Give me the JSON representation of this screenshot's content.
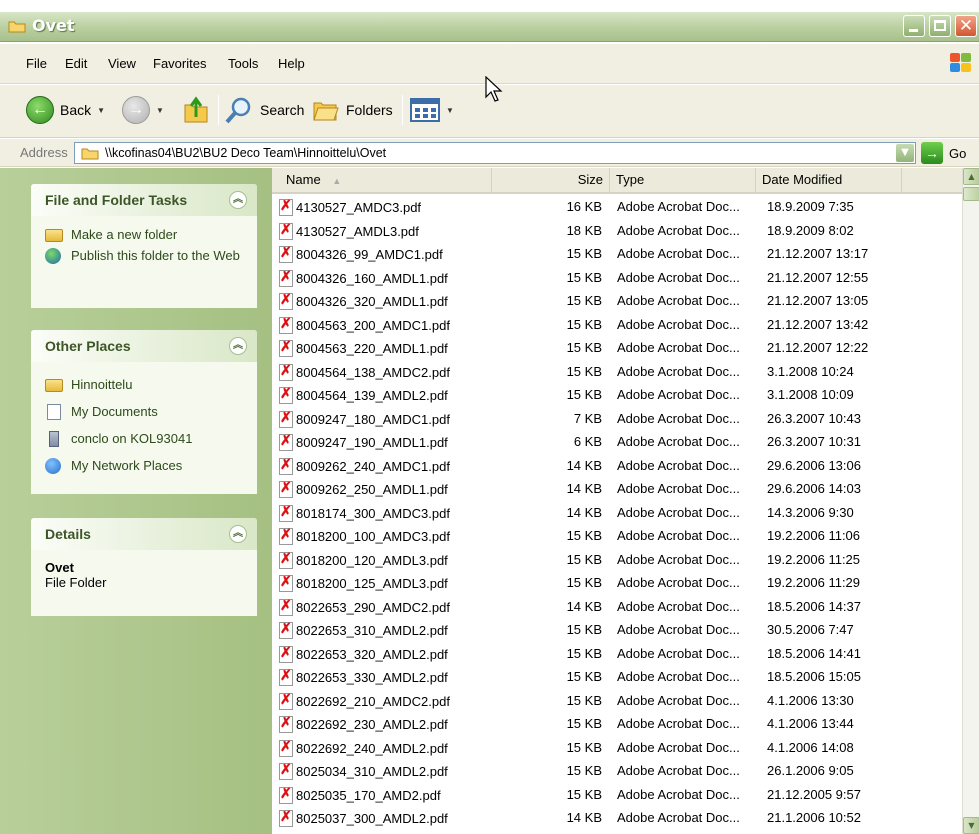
{
  "window": {
    "title": "Ovet"
  },
  "menu": [
    "File",
    "Edit",
    "View",
    "Favorites",
    "Tools",
    "Help"
  ],
  "toolbar": {
    "back": "Back",
    "search": "Search",
    "folders": "Folders"
  },
  "address": {
    "label": "Address",
    "path": "\\\\kcofinas04\\BU2\\BU2 Deco Team\\Hinnoittelu\\Ovet",
    "go": "Go"
  },
  "tasks_panel": {
    "title": "File and Folder Tasks",
    "items": [
      "Make a new folder",
      "Publish this folder to the Web"
    ]
  },
  "places_panel": {
    "title": "Other Places",
    "items": [
      "Hinnoittelu",
      "My Documents",
      "conclo on KOL93041",
      "My Network Places"
    ]
  },
  "details_panel": {
    "title": "Details",
    "name": "Ovet",
    "type": "File Folder"
  },
  "columns": {
    "name": "Name",
    "size": "Size",
    "type": "Type",
    "date": "Date Modified"
  },
  "files": [
    {
      "name": "4130527_AMDC3.pdf",
      "size": "16 KB",
      "type": "Adobe Acrobat Doc...",
      "date": "18.9.2009 7:35"
    },
    {
      "name": "4130527_AMDL3.pdf",
      "size": "18 KB",
      "type": "Adobe Acrobat Doc...",
      "date": "18.9.2009 8:02"
    },
    {
      "name": "8004326_99_AMDC1.pdf",
      "size": "15 KB",
      "type": "Adobe Acrobat Doc...",
      "date": "21.12.2007 13:17"
    },
    {
      "name": "8004326_160_AMDL1.pdf",
      "size": "15 KB",
      "type": "Adobe Acrobat Doc...",
      "date": "21.12.2007 12:55"
    },
    {
      "name": "8004326_320_AMDL1.pdf",
      "size": "15 KB",
      "type": "Adobe Acrobat Doc...",
      "date": "21.12.2007 13:05"
    },
    {
      "name": "8004563_200_AMDC1.pdf",
      "size": "15 KB",
      "type": "Adobe Acrobat Doc...",
      "date": "21.12.2007 13:42"
    },
    {
      "name": "8004563_220_AMDL1.pdf",
      "size": "15 KB",
      "type": "Adobe Acrobat Doc...",
      "date": "21.12.2007 12:22"
    },
    {
      "name": "8004564_138_AMDC2.pdf",
      "size": "15 KB",
      "type": "Adobe Acrobat Doc...",
      "date": "3.1.2008 10:24"
    },
    {
      "name": "8004564_139_AMDL2.pdf",
      "size": "15 KB",
      "type": "Adobe Acrobat Doc...",
      "date": "3.1.2008 10:09"
    },
    {
      "name": "8009247_180_AMDC1.pdf",
      "size": "7 KB",
      "type": "Adobe Acrobat Doc...",
      "date": "26.3.2007 10:43"
    },
    {
      "name": "8009247_190_AMDL1.pdf",
      "size": "6 KB",
      "type": "Adobe Acrobat Doc...",
      "date": "26.3.2007 10:31"
    },
    {
      "name": "8009262_240_AMDC1.pdf",
      "size": "14 KB",
      "type": "Adobe Acrobat Doc...",
      "date": "29.6.2006 13:06"
    },
    {
      "name": "8009262_250_AMDL1.pdf",
      "size": "14 KB",
      "type": "Adobe Acrobat Doc...",
      "date": "29.6.2006 14:03"
    },
    {
      "name": "8018174_300_AMDC3.pdf",
      "size": "14 KB",
      "type": "Adobe Acrobat Doc...",
      "date": "14.3.2006 9:30"
    },
    {
      "name": "8018200_100_AMDC3.pdf",
      "size": "15 KB",
      "type": "Adobe Acrobat Doc...",
      "date": "19.2.2006 11:06"
    },
    {
      "name": "8018200_120_AMDL3.pdf",
      "size": "15 KB",
      "type": "Adobe Acrobat Doc...",
      "date": "19.2.2006 11:25"
    },
    {
      "name": "8018200_125_AMDL3.pdf",
      "size": "15 KB",
      "type": "Adobe Acrobat Doc...",
      "date": "19.2.2006 11:29"
    },
    {
      "name": "8022653_290_AMDC2.pdf",
      "size": "14 KB",
      "type": "Adobe Acrobat Doc...",
      "date": "18.5.2006 14:37"
    },
    {
      "name": "8022653_310_AMDL2.pdf",
      "size": "15 KB",
      "type": "Adobe Acrobat Doc...",
      "date": "30.5.2006 7:47"
    },
    {
      "name": "8022653_320_AMDL2.pdf",
      "size": "15 KB",
      "type": "Adobe Acrobat Doc...",
      "date": "18.5.2006 14:41"
    },
    {
      "name": "8022653_330_AMDL2.pdf",
      "size": "15 KB",
      "type": "Adobe Acrobat Doc...",
      "date": "18.5.2006 15:05"
    },
    {
      "name": "8022692_210_AMDC2.pdf",
      "size": "15 KB",
      "type": "Adobe Acrobat Doc...",
      "date": "4.1.2006 13:30"
    },
    {
      "name": "8022692_230_AMDL2.pdf",
      "size": "15 KB",
      "type": "Adobe Acrobat Doc...",
      "date": "4.1.2006 13:44"
    },
    {
      "name": "8022692_240_AMDL2.pdf",
      "size": "15 KB",
      "type": "Adobe Acrobat Doc...",
      "date": "4.1.2006 14:08"
    },
    {
      "name": "8025034_310_AMDL2.pdf",
      "size": "15 KB",
      "type": "Adobe Acrobat Doc...",
      "date": "26.1.2006 9:05"
    },
    {
      "name": "8025035_170_AMD2.pdf",
      "size": "15 KB",
      "type": "Adobe Acrobat Doc...",
      "date": "21.12.2005 9:57"
    },
    {
      "name": "8025037_300_AMDL2.pdf",
      "size": "14 KB",
      "type": "Adobe Acrobat Doc...",
      "date": "21.1.2006 10:52"
    }
  ]
}
